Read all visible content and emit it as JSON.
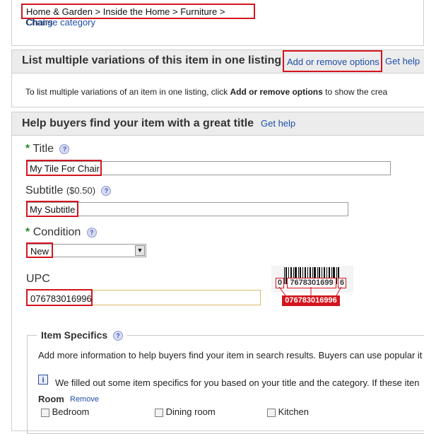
{
  "category": {
    "breadcrumb": "Home & Garden > Inside the Home > Furniture > Chairs",
    "change_link": "Change category"
  },
  "variations": {
    "title": "List multiple variations of this item in one listing",
    "add_remove_button": "Add or remove options",
    "help_link": "Get help",
    "desc_prefix": "To list multiple variations of an item in one listing, click ",
    "desc_bold": "Add or remove options",
    "desc_suffix": " to show the crea"
  },
  "title_section": {
    "heading": "Help buyers find your item with a great title",
    "help_link": "Get help",
    "title_label": "Title",
    "title_value": "My Tile For Chair",
    "subtitle_label": "Subtitle",
    "subtitle_price": "($0.50)",
    "subtitle_value": "My Subtitle",
    "condition_label": "Condition",
    "condition_value": "New",
    "upc_label": "UPC",
    "upc_value": "076783016996",
    "barcode": {
      "left_digit": "0",
      "middle_digits": "7678301699",
      "right_digit": "6",
      "caption": "076783016996"
    },
    "required_mark": "*",
    "help_glyph": "?"
  },
  "item_specifics": {
    "legend": "Item Specifics",
    "desc": "Add more information to help buyers find your item in search results. Buyers can use popular it",
    "info_text": "We filled out some item specifics for you based on your title and the category. If these iten",
    "info_glyph": "i",
    "room_label": "Room",
    "room_remove": "Remove",
    "options": [
      "Bedroom",
      "Dining room",
      "Kitchen"
    ]
  },
  "colors": {
    "highlight_red": "#d4141d",
    "link_blue": "#1f4ea8",
    "required_green": "#2a8a2a"
  }
}
